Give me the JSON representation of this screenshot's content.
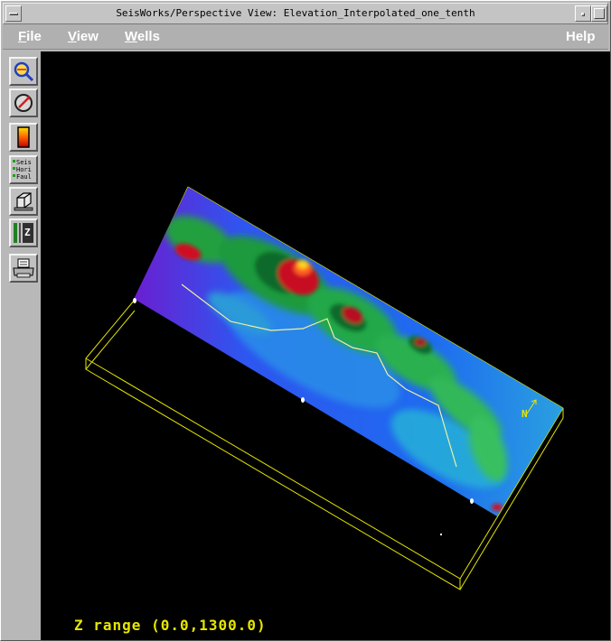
{
  "window": {
    "title": "SeisWorks/Perspective View: Elevation_Interpolated_one_tenth"
  },
  "menubar": {
    "file": {
      "mnemonic": "F",
      "rest": "ile"
    },
    "view": {
      "mnemonic": "V",
      "rest": "iew"
    },
    "wells": {
      "mnemonic": "W",
      "rest": "ells"
    },
    "help": "Help"
  },
  "toolbar": {
    "buttons": [
      {
        "icon": "zoom-magnifier-icon"
      },
      {
        "icon": "rotate-dial-icon"
      },
      {
        "icon": "color-scale-icon"
      },
      {
        "icon": "object-toggle-icon",
        "lines": [
          "Seis",
          "Hori",
          "Faul"
        ]
      },
      {
        "icon": "cube-view-icon"
      },
      {
        "icon": "z-scale-icon",
        "label": "Z"
      },
      {
        "icon": "print-icon"
      }
    ]
  },
  "viewport": {
    "z_range_label": "Z range (0.0,1300.0)",
    "north_label": "N",
    "colors": {
      "background": "#000000",
      "outline": "#e6e600",
      "fault_line": "#f0f0a0",
      "surface_low": "#6a1fd0",
      "surface_mid": "#1e6cf0",
      "surface_green": "#20a040",
      "surface_high": "#d01020",
      "surface_peak": "#ffd020"
    }
  }
}
